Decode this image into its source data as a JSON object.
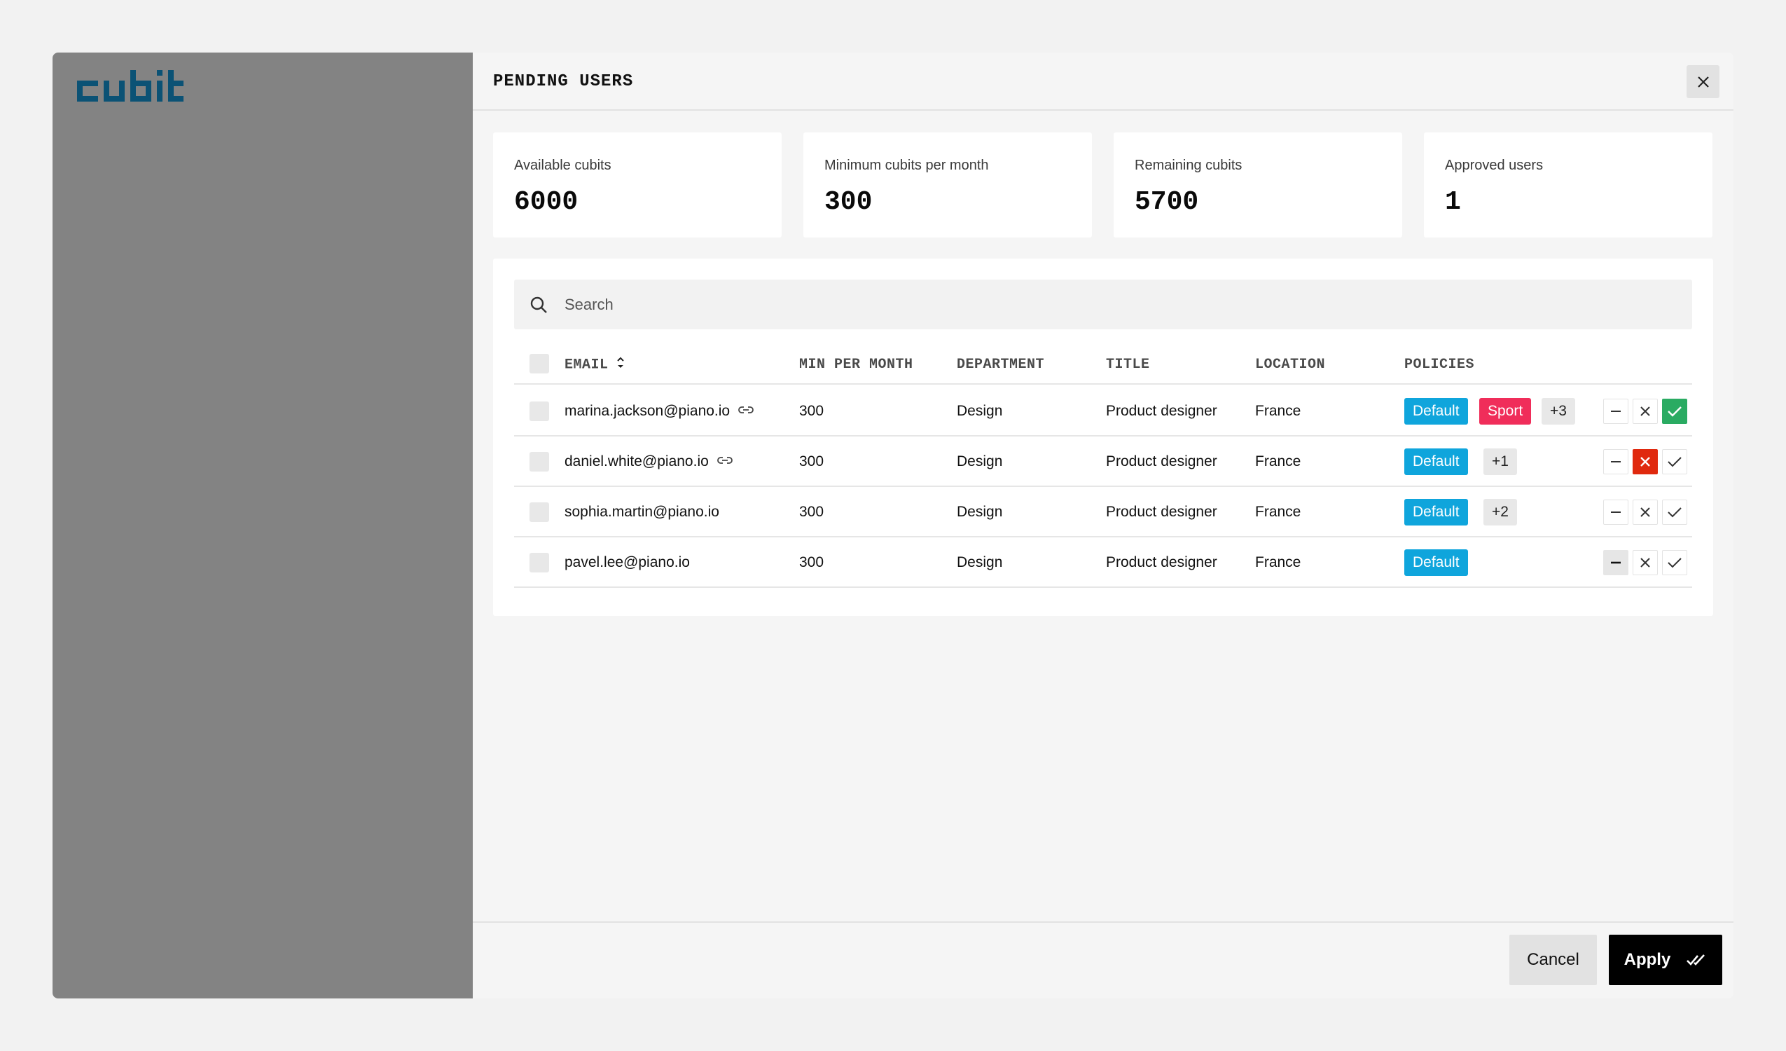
{
  "brand": {
    "logo_text": "cubit",
    "color": "#0b5275"
  },
  "header": {
    "title": "PENDING USERS",
    "close_icon": "close-icon"
  },
  "stats": [
    {
      "label": "Available cubits",
      "value": "6000"
    },
    {
      "label": "Minimum cubits per month",
      "value": "300"
    },
    {
      "label": "Remaining cubits",
      "value": "5700"
    },
    {
      "label": "Approved users",
      "value": "1"
    }
  ],
  "search": {
    "placeholder": "Search",
    "value": ""
  },
  "table": {
    "columns": {
      "email": "EMAIL",
      "min_per_month": "MIN PER MONTH",
      "department": "DEPARTMENT",
      "title": "TITLE",
      "location": "LOCATION",
      "policies": "POLICIES"
    },
    "rows": [
      {
        "email": "marina.jackson@piano.io",
        "linked": true,
        "min": "300",
        "department": "Design",
        "title": "Product designer",
        "location": "France",
        "policies": [
          "Default",
          "Sport"
        ],
        "more": "+3",
        "status": "approved"
      },
      {
        "email": "daniel.white@piano.io",
        "linked": true,
        "min": "300",
        "department": "Design",
        "title": "Product designer",
        "location": "France",
        "policies": [
          "Default"
        ],
        "more": "+1",
        "status": "rejected"
      },
      {
        "email": "sophia.martin@piano.io",
        "linked": false,
        "min": "300",
        "department": "Design",
        "title": "Product designer",
        "location": "France",
        "policies": [
          "Default"
        ],
        "more": "+2",
        "status": "none"
      },
      {
        "email": "pavel.lee@piano.io",
        "linked": false,
        "min": "300",
        "department": "Design",
        "title": "Product designer",
        "location": "France",
        "policies": [
          "Default"
        ],
        "more": "",
        "status": "pending"
      }
    ]
  },
  "colors": {
    "default_tag": "#0fa5dc",
    "sport_tag": "#f02d5a",
    "approve": "#2aab62",
    "reject": "#e0290e"
  },
  "footer": {
    "cancel_label": "Cancel",
    "apply_label": "Apply"
  }
}
